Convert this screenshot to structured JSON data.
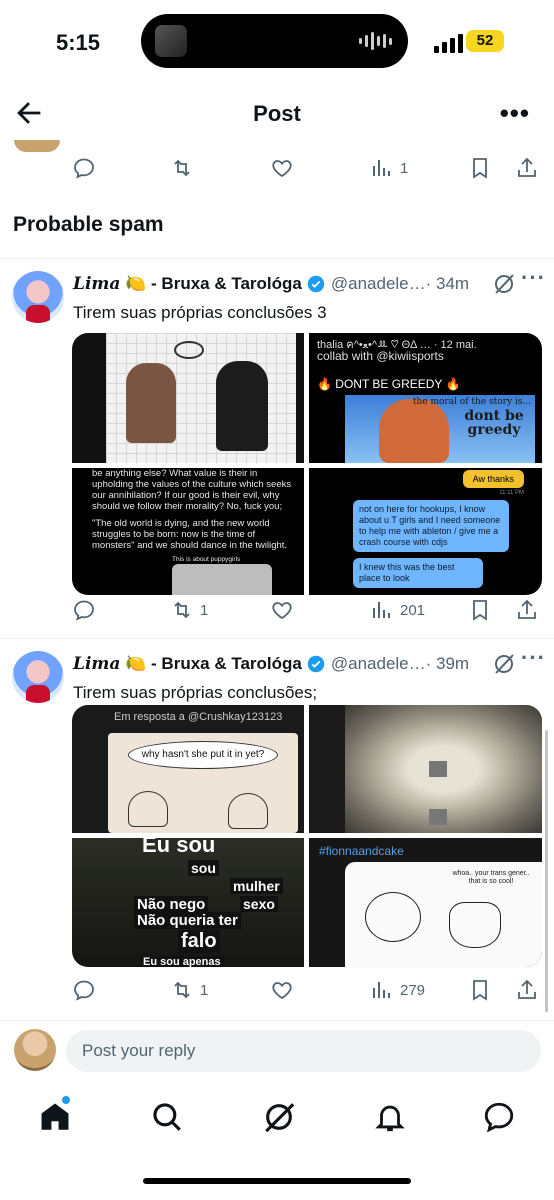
{
  "status": {
    "time": "5:15",
    "battery": "52"
  },
  "header": {
    "title": "Post"
  },
  "top_actions": {
    "views": "1"
  },
  "section_title": "Probable spam",
  "tweets": [
    {
      "name_script": "Lima",
      "name_emoji": "🍋",
      "name_rest": " - Bruxa & Tarológa",
      "handle": "@anadele…",
      "time": "· 34m",
      "text": "Tirem suas próprias conclusões 3",
      "images": {
        "tr_header": "thalia ฅ^•ﻌ•^ꔛ ♡ ΘΔ … · 12 mai.",
        "tr_collab": "collab with @kiwiisports",
        "tr_greedy": "🔥 DONT BE GREEDY 🔥",
        "tr_moral": "the moral of the story is...",
        "tr_dont": "dont be greedy",
        "bl_text1": "be anything else? What value is their in upholding the values of the culture which seeks our annihilation? If our good is their evil, why should we follow their morality? No, fuck you;",
        "bl_text2": "\"The old world is dying, and the new world struggles to be born: now is the time of monsters\" and we should dance in the twilight.",
        "bl_small": "This is about puppygirls",
        "br_bubble1": "Aw thanks",
        "br_time": "11:11 PM",
        "br_bubble2": "not on here for hookups, I know about u T girls and I need someone to help me with ableton / give me a crash course with cdjs",
        "br_bubble3": "I knew this was the best place to look"
      },
      "actions": {
        "reposts": "1",
        "views": "201"
      }
    },
    {
      "name_script": "Lima",
      "name_emoji": "🍋",
      "name_rest": " - Bruxa & Tarológa",
      "handle": "@anadele…",
      "time": "· 39m",
      "text": "Tirem suas próprias conclusões;",
      "images": {
        "tl_header": "Em resposta a @Crushkay123123",
        "tl_bubble": "why hasn't she put it in yet?",
        "bl_words": [
          "Eu sou",
          "sou",
          "mulher",
          "sexo",
          "Não nego",
          "Não queria ter",
          "falo",
          "Eu sou apenas"
        ],
        "br_header": "#fionnaandcake",
        "br_speech": "whoa.. your trans gener.. that is so cool!"
      },
      "actions": {
        "reposts": "1",
        "views": "279"
      }
    }
  ],
  "reply": {
    "placeholder": "Post your reply"
  },
  "colors": {
    "accent": "#1d9bf0",
    "muted": "#536471",
    "text": "#0f1419"
  },
  "icons": [
    "back-arrow-icon",
    "more-icon",
    "reply-icon",
    "repost-icon",
    "like-icon",
    "views-icon",
    "bookmark-icon",
    "share-icon",
    "verified-icon",
    "grok-icon",
    "home-icon",
    "search-icon",
    "bell-icon",
    "messages-icon"
  ]
}
